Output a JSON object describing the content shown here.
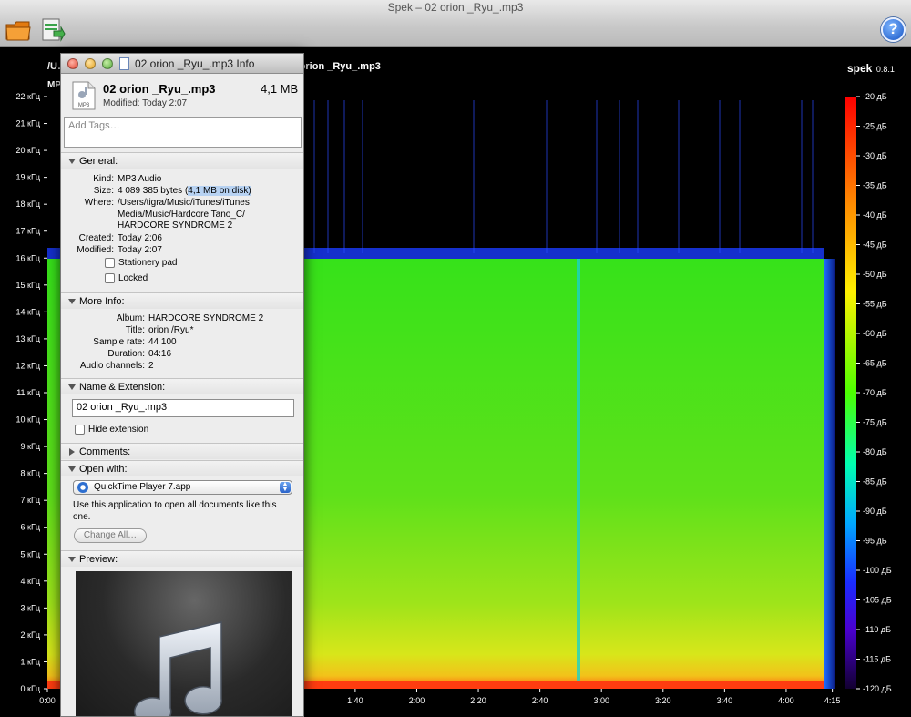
{
  "window": {
    "title": "Spek – 02 orion _Ryu_.mp3",
    "help_label": "?"
  },
  "toolbar": {
    "open_icon": "folder-icon",
    "save_icon": "save-icon",
    "help_icon": "help-icon"
  },
  "spectrogram": {
    "file_path": "/U… Hardcore Tano_C/HARDCORE SYNDROME 2/02 orion _Ryu_.mp3",
    "info_line": "MP… канала",
    "brand_name": "spek",
    "brand_version": "0.8.1",
    "freq_labels": [
      "22 кГц",
      "21 кГц",
      "20 кГц",
      "19 кГц",
      "18 кГц",
      "17 кГц",
      "16 кГц",
      "15 кГц",
      "14 кГц",
      "13 кГц",
      "12 кГц",
      "11 кГц",
      "10 кГц",
      "9 кГц",
      "8 кГц",
      "7 кГц",
      "6 кГц",
      "5 кГц",
      "4 кГц",
      "3 кГц",
      "2 кГц",
      "1 кГц",
      "0 кГц"
    ],
    "time_labels": [
      "0:00",
      "1:40",
      "2:00",
      "2:20",
      "2:40",
      "3:00",
      "3:20",
      "3:40",
      "4:00",
      "4:15"
    ],
    "time_values_sec": [
      0,
      100,
      120,
      140,
      160,
      180,
      200,
      220,
      240,
      255
    ],
    "duration_sec": 256,
    "db_labels": [
      "-20 дБ",
      "-25 дБ",
      "-30 дБ",
      "-35 дБ",
      "-40 дБ",
      "-45 дБ",
      "-50 дБ",
      "-55 дБ",
      "-60 дБ",
      "-65 дБ",
      "-70 дБ",
      "-75 дБ",
      "-80 дБ",
      "-85 дБ",
      "-90 дБ",
      "-95 дБ",
      "-100 дБ",
      "-105 дБ",
      "-110 дБ",
      "-115 дБ",
      "-120 дБ"
    ],
    "cutoff_khz": 16
  },
  "info_panel": {
    "title": "02 orion _Ryu_.mp3 Info",
    "file_name": "02 orion _Ryu_.mp3",
    "file_size": "4,1 MB",
    "modified": "Modified: Today 2:07",
    "tags_placeholder": "Add Tags…",
    "general": {
      "heading": "General:",
      "kind_label": "Kind:",
      "kind": "MP3 Audio",
      "size_label": "Size:",
      "size": "4 089 385 bytes (",
      "size_disk": "4,1 MB on disk)",
      "where_label": "Where:",
      "where_1": "/Users/tigra/Music/iTunes/iTunes",
      "where_2": "Media/Music/Hardcore Tano_C/",
      "where_3": "HARDCORE SYNDROME 2",
      "created_label": "Created:",
      "created": "Today 2:06",
      "modified_label": "Modified:",
      "modified": "Today 2:07",
      "stationery": "Stationery pad",
      "locked": "Locked"
    },
    "more_info": {
      "heading": "More Info:",
      "album_label": "Album:",
      "album": "HARDCORE SYNDROME 2",
      "title_label": "Title:",
      "title": "orion /Ryu*",
      "rate_label": "Sample rate:",
      "rate": "44 100",
      "duration_label": "Duration:",
      "duration": "04:16",
      "channels_label": "Audio channels:",
      "channels": "2"
    },
    "name_ext": {
      "heading": "Name & Extension:",
      "value": "02 orion _Ryu_.mp3",
      "hide_ext": "Hide extension"
    },
    "comments": {
      "heading": "Comments:"
    },
    "open_with": {
      "heading": "Open with:",
      "app": "QuickTime Player 7.app",
      "desc": "Use this application to open all documents like this one.",
      "change_all": "Change All…"
    },
    "preview": {
      "heading": "Preview:"
    },
    "file_badge": "MP3"
  }
}
